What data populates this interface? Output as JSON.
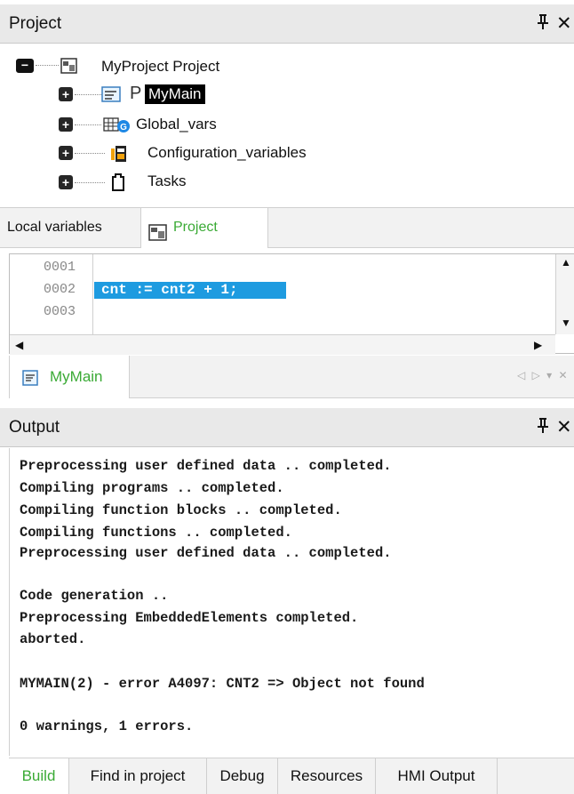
{
  "project_panel": {
    "title": "Project",
    "pin_icon": "pin-icon",
    "close_icon": "close-icon",
    "tree": {
      "root": {
        "label": "MyProject Project",
        "expanded": true
      },
      "children": [
        {
          "label": "MyMain",
          "selected": true,
          "prefix": "P"
        },
        {
          "label": "Global_vars"
        },
        {
          "label": "Configuration_variables"
        },
        {
          "label": "Tasks"
        }
      ]
    }
  },
  "var_tabs": {
    "local_label": "Local variables",
    "project_label": "Project"
  },
  "editor": {
    "line_numbers": [
      "0001",
      "0002",
      "0003"
    ],
    "lines": [
      "",
      "cnt := cnt2 + 1;",
      ""
    ],
    "highlighted_line": 2,
    "doc_tab": {
      "label": "MyMain"
    },
    "doc_nav": "◁ ▷ ▾ ✕"
  },
  "output_panel": {
    "title": "Output",
    "lines": [
      "Preprocessing user defined data .. completed.",
      "Compiling programs .. completed.",
      "Compiling function blocks .. completed.",
      "Compiling functions .. completed.",
      "Preprocessing user defined data .. completed.",
      "",
      "Code generation ..",
      "Preprocessing EmbeddedElements completed.",
      "aborted.",
      "",
      "MYMAIN(2) - error A4097: CNT2 => Object not found",
      "",
      "0 warnings, 1 errors."
    ],
    "tabs": [
      "Build",
      "Find in project",
      "Debug",
      "Resources",
      "HMI Output"
    ],
    "active_tab": "Build"
  },
  "colors": {
    "header_bg": "#e9e9e9",
    "active_tab_text": "#3aaa35",
    "highlight": "#1e9be0",
    "selected_bg": "#000000"
  }
}
